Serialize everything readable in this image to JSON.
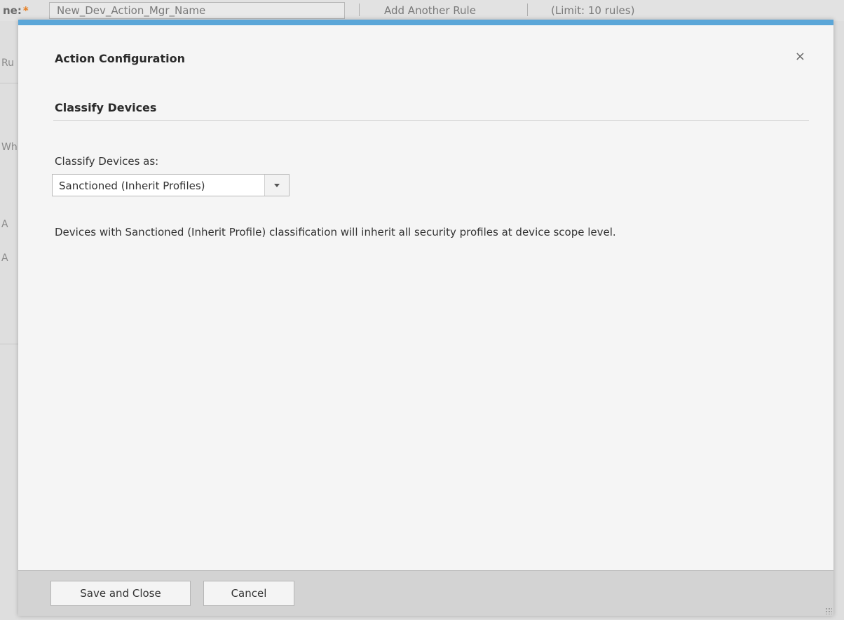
{
  "background": {
    "label_fragment": "ne:",
    "required_mark": "*",
    "name_value": "New_Dev_Action_Mgr_Name",
    "add_rule": "Add Another Rule",
    "limit": "(Limit: 10 rules)",
    "side_fragments": [
      "Ru",
      "Wh",
      "A",
      "A"
    ]
  },
  "modal": {
    "title": "Action Configuration",
    "close_symbol": "×",
    "section_title": "Classify Devices",
    "field_label": "Classify Devices as:",
    "select_value": "Sanctioned (Inherit Profiles)",
    "description": "Devices with Sanctioned (Inherit Profile) classification will inherit all security profiles at device scope level.",
    "accent_color": "#5ba6d8"
  },
  "footer": {
    "save_label": "Save and Close",
    "cancel_label": "Cancel"
  }
}
